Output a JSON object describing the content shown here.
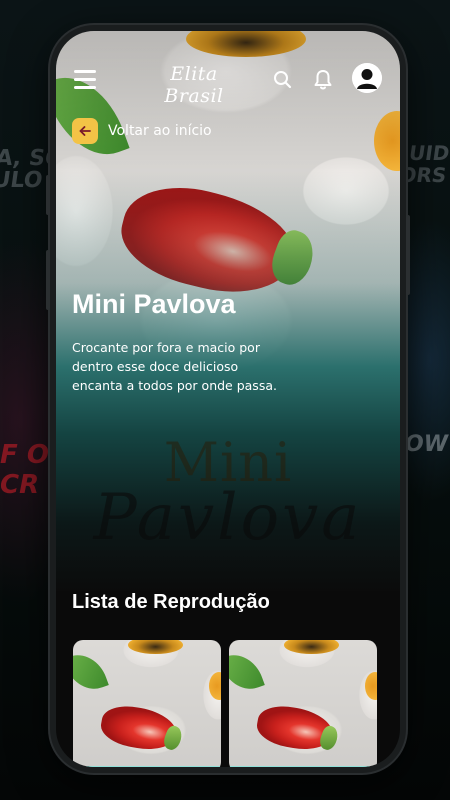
{
  "header": {
    "logo_text": "Elita Brasil",
    "icons": [
      "menu-icon",
      "search-icon",
      "bell-icon",
      "user-avatar-icon"
    ]
  },
  "back": {
    "label": "Voltar ao início",
    "icon": "arrow-left-icon",
    "accent_color": "#f3c346"
  },
  "hero": {
    "title": "Mini Pavlova",
    "description": "Crocante por fora e macio por dentro esse doce delicioso encanta a todos por onde passa.",
    "watermark_line1": "Mini",
    "watermark_line2": "Pavlova"
  },
  "playlist": {
    "title": "Lista de Reprodução",
    "items": [
      {
        "thumbnail": "mini-pavlova"
      },
      {
        "thumbnail": "mini-pavlova"
      }
    ]
  },
  "colors": {
    "teal": "#0e5f5c",
    "background": "#0b0b0b",
    "accent": "#f3c346"
  }
}
